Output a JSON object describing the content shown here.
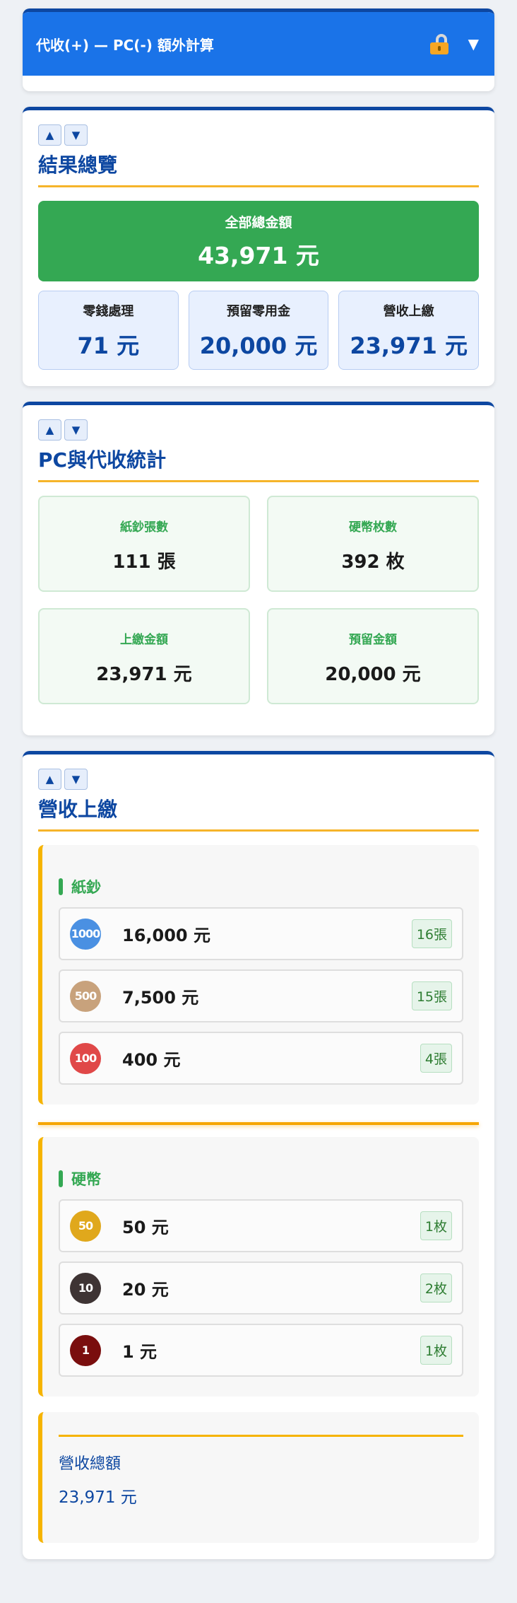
{
  "header": {
    "title": "代收(+) — PC(-) 額外計算",
    "lock_icon": "unlocked-padlock-icon",
    "toggle_icon": "▼"
  },
  "controls": {
    "up": "▲",
    "down": "▼"
  },
  "overview": {
    "title": "結果總覽",
    "total_label": "全部總金額",
    "total_value": "43,971 元",
    "items": [
      {
        "label": "零錢處理",
        "value": "71 元"
      },
      {
        "label": "預留零用金",
        "value": "20,000 元"
      },
      {
        "label": "營收上繳",
        "value": "23,971 元"
      }
    ]
  },
  "stats": {
    "title": "PC與代收統計",
    "items": [
      {
        "label": "紙鈔張數",
        "value": "111 張"
      },
      {
        "label": "硬幣枚數",
        "value": "392 枚"
      },
      {
        "label": "上繳金額",
        "value": "23,971 元"
      },
      {
        "label": "預留金額",
        "value": "20,000 元"
      }
    ]
  },
  "revenue": {
    "title": "營收上繳",
    "bills": {
      "title": "紙鈔",
      "rows": [
        {
          "badge": "1000",
          "color": "#4a90e2",
          "amount": "16,000 元",
          "count": "16張"
        },
        {
          "badge": "500",
          "color": "#c8a27c",
          "amount": "7,500 元",
          "count": "15張"
        },
        {
          "badge": "100",
          "color": "#e04848",
          "amount": "400 元",
          "count": "4張"
        }
      ]
    },
    "coins": {
      "title": "硬幣",
      "rows": [
        {
          "badge": "50",
          "color": "#e0a81c",
          "amount": "50 元",
          "count": "1枚"
        },
        {
          "badge": "10",
          "color": "#3e3434",
          "amount": "20 元",
          "count": "2枚"
        },
        {
          "badge": "1",
          "color": "#7a0e0e",
          "amount": "1 元",
          "count": "1枚"
        }
      ]
    },
    "total_label": "營收總額",
    "total_value": "23,971 元"
  }
}
